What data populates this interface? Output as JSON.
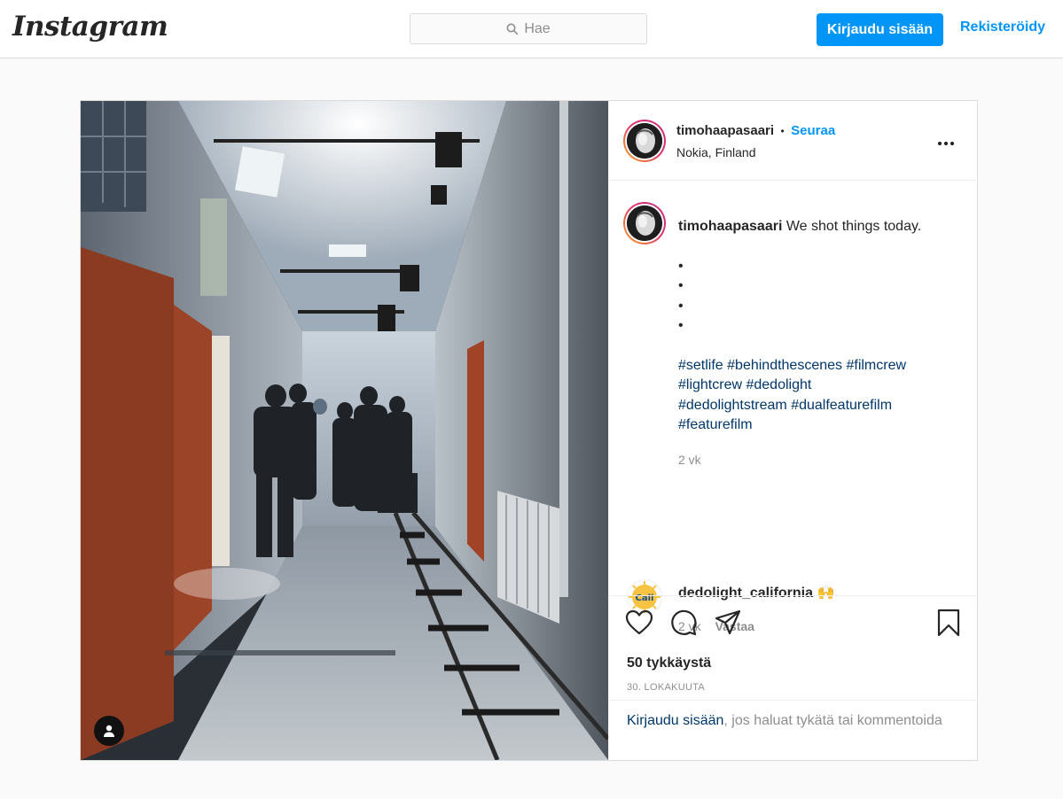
{
  "header": {
    "logo": "Instagram",
    "search_placeholder": "Hae",
    "login_label": "Kirjaudu sisään",
    "register_label": "Rekisteröidy",
    "accent": "#0095f6"
  },
  "post": {
    "author": {
      "username": "timohaapasaari",
      "follow_label": "Seuraa",
      "separator": "•",
      "location": "Nokia, Finland"
    },
    "more_icon": "more-horizontal-icon",
    "caption": {
      "username": "timohaapasaari",
      "text": "We shot things today.",
      "bullets": [
        "•",
        "•",
        "•",
        "•"
      ],
      "hashtag_lines": [
        "#setlife #behindthescenes #filmcrew",
        "#lightcrew #dedolight",
        "#dedolightstream #dualfeaturefilm",
        "#featurefilm"
      ],
      "age": "2 vk"
    },
    "comments": [
      {
        "username": "dedolight_california",
        "text": "🙌",
        "age": "2 vk",
        "reply_label": "Vastaa"
      }
    ],
    "likes": "50 tykkäystä",
    "date": "30. LOKAKUUTA",
    "login_prompt": {
      "link": "Kirjaudu sisään",
      "rest": ", jos haluat tykätä tai kommentoida"
    }
  }
}
